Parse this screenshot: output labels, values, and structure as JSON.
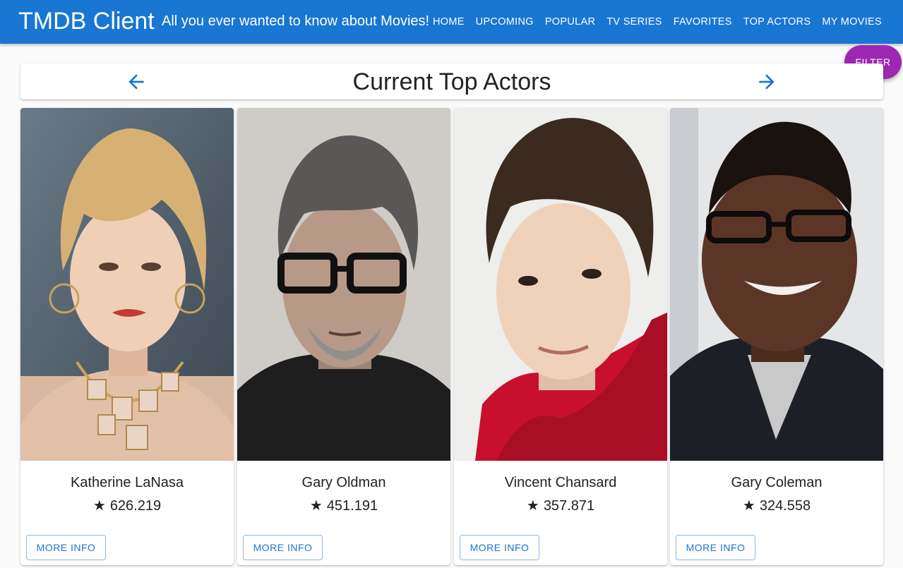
{
  "app": {
    "title": "TMDB Client",
    "tagline": "All you ever wanted to know about Movies!"
  },
  "nav": {
    "items": [
      "HOME",
      "UPCOMING",
      "POPULAR",
      "TV SERIES",
      "FAVORITES",
      "TOP ACTORS",
      "MY MOVIES"
    ]
  },
  "header": {
    "title": "Current Top Actors",
    "prev_icon": "arrow-left-icon",
    "next_icon": "arrow-right-icon"
  },
  "filter": {
    "label": "FILTER"
  },
  "colors": {
    "primary": "#1976d2",
    "accent": "#9c27b0"
  },
  "actors": [
    {
      "name": "Katherine LaNasa",
      "popularity": "626.219",
      "button": "MORE INFO"
    },
    {
      "name": "Gary Oldman",
      "popularity": "451.191",
      "button": "MORE INFO"
    },
    {
      "name": "Vincent Chansard",
      "popularity": "357.871",
      "button": "MORE INFO"
    },
    {
      "name": "Gary Coleman",
      "popularity": "324.558",
      "button": "MORE INFO"
    }
  ],
  "rating_icon": "star-icon",
  "star_glyph": "★"
}
